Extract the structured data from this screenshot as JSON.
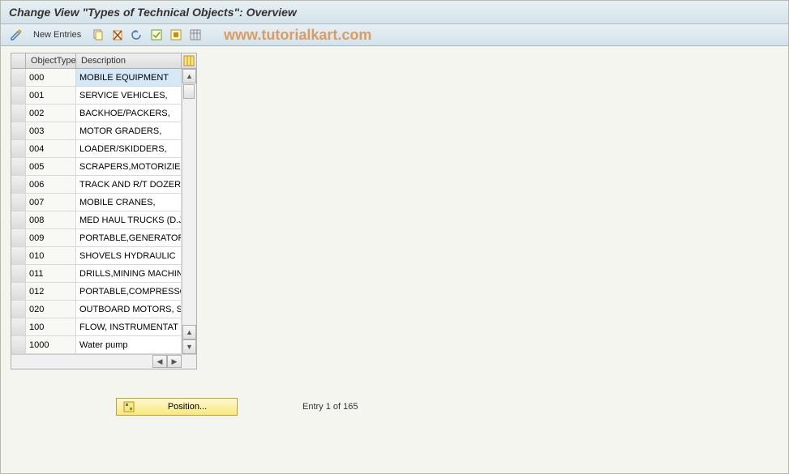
{
  "title": "Change View \"Types of Technical Objects\": Overview",
  "toolbar": {
    "new_entries_label": "New Entries"
  },
  "watermark": "www.tutorialkart.com",
  "grid": {
    "headers": {
      "object_type": "ObjectType",
      "description": "Description"
    },
    "rows": [
      {
        "type": "000",
        "desc": "MOBILE EQUIPMENT",
        "selected": true
      },
      {
        "type": "001",
        "desc": "SERVICE VEHICLES,"
      },
      {
        "type": "002",
        "desc": "BACKHOE/PACKERS,"
      },
      {
        "type": "003",
        "desc": "MOTOR GRADERS,"
      },
      {
        "type": "004",
        "desc": "LOADER/SKIDDERS,"
      },
      {
        "type": "005",
        "desc": "SCRAPERS,MOTORIZIED"
      },
      {
        "type": "006",
        "desc": "TRACK AND R/T DOZER"
      },
      {
        "type": "007",
        "desc": "MOBILE CRANES,"
      },
      {
        "type": "008",
        "desc": "MED HAUL TRUCKS (D.J"
      },
      {
        "type": "009",
        "desc": "PORTABLE,GENERATOR"
      },
      {
        "type": "010",
        "desc": "SHOVELS HYDRAULIC"
      },
      {
        "type": "011",
        "desc": "DRILLS,MINING MACHIN"
      },
      {
        "type": "012",
        "desc": "PORTABLE,COMPRESSO"
      },
      {
        "type": "020",
        "desc": "OUTBOARD MOTORS, S"
      },
      {
        "type": "100",
        "desc": "FLOW, INSTRUMENTAT"
      },
      {
        "type": "1000",
        "desc": "Water pump"
      }
    ]
  },
  "footer": {
    "position_label": "Position...",
    "entry_text": "Entry 1 of 165"
  }
}
